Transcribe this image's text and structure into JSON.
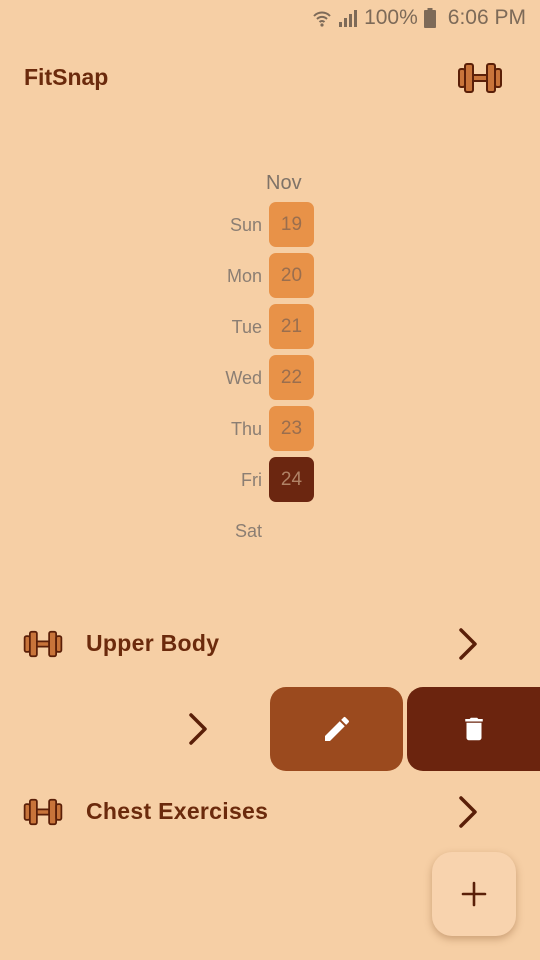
{
  "status_bar": {
    "battery_text": "100%",
    "time": "6:06 PM",
    "icons": [
      "wifi-icon",
      "signal-icon",
      "battery-icon"
    ]
  },
  "header": {
    "title": "FitSnap",
    "icon": "dumbbell-icon"
  },
  "calendar": {
    "month": "Nov",
    "days": [
      {
        "name": "Sun",
        "number": "19"
      },
      {
        "name": "Mon",
        "number": "20"
      },
      {
        "name": "Tue",
        "number": "21"
      },
      {
        "name": "Wed",
        "number": "22"
      },
      {
        "name": "Thu",
        "number": "23"
      },
      {
        "name": "Fri",
        "number": "24",
        "selected": true
      },
      {
        "name": "Sat",
        "number": ""
      }
    ]
  },
  "workouts": [
    {
      "label": "Upper Body",
      "icon": "dumbbell-icon"
    },
    {
      "label": "",
      "icon": "",
      "swiped": true
    },
    {
      "label": "Chest Exercises",
      "icon": "dumbbell-icon"
    }
  ],
  "actions": {
    "edit_icon": "pencil-icon",
    "delete_icon": "trash-icon",
    "add_icon": "plus-icon"
  },
  "colors": {
    "background": "#f6cfa5",
    "primary_dark": "#6b2a0c",
    "day_chip": "#e89248",
    "day_chip_selected": "#6b2610",
    "edit": "#9b4a1e",
    "delete": "#6b240e"
  }
}
